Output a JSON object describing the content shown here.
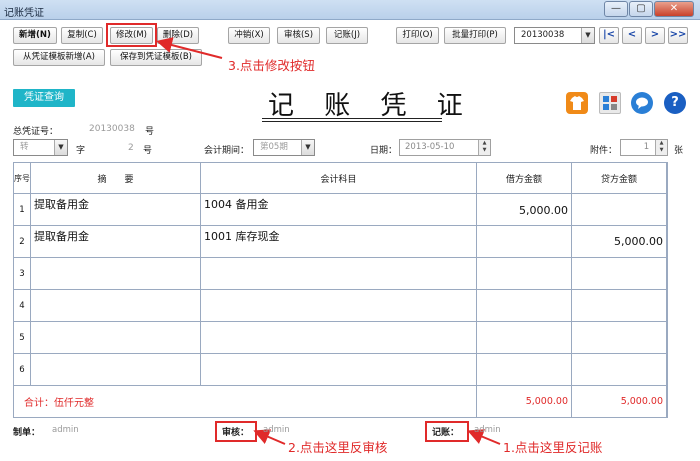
{
  "window": {
    "title": "记账凭证",
    "minimize": "—",
    "maximize": "▢",
    "close": "✕"
  },
  "toolbar": {
    "new": "新增(N)",
    "copy": "复制(C)",
    "modify": "修改(M)",
    "delete": "删除(D)",
    "reverse": "冲销(X)",
    "audit": "审核(S)",
    "post": "记账(J)",
    "print": "打印(O)",
    "batch_print": "批量打印(P)",
    "from_template": "从凭证模板新增(A)",
    "save_template": "保存到凭证模板(B)",
    "voucher_select": "20130038",
    "nav": {
      "first": "|<",
      "prev": "<",
      "next": ">",
      "last": ">>"
    }
  },
  "annotations": {
    "step1": "1.点击这里反记账",
    "step2": "2.点击这里反审核",
    "step3": "3.点击修改按钮"
  },
  "colors": {
    "accent_red": "#e02a2a",
    "tag_teal": "#1fb5c8"
  },
  "voucher": {
    "query_tag": "凭证查询",
    "title": "记 账 凭 证",
    "total_no_label": "总凭证号：",
    "total_no": "20130038",
    "total_no_suffix": "号",
    "type": "转",
    "type_suffix": "字",
    "number": "2",
    "number_suffix": "号",
    "period_label": "会计期间：",
    "period": "第05期",
    "date_label": "日期：",
    "date": "2013-05-10",
    "attach_label": "附件：",
    "attach": "1",
    "attach_suffix": "张",
    "icons": [
      "shirt-icon",
      "calculator-icon",
      "chat-icon",
      "help-icon"
    ]
  },
  "table": {
    "headers": {
      "seq": "序号",
      "summary": "摘　　要",
      "account": "会计科目",
      "debit": "借方金额",
      "credit": "贷方金额"
    },
    "rows": [
      {
        "seq": "1",
        "summary": "提取备用金",
        "account": "1004 备用金",
        "debit": "5,000.00",
        "credit": ""
      },
      {
        "seq": "2",
        "summary": "提取备用金",
        "account": "1001 库存现金",
        "debit": "",
        "credit": "5,000.00"
      },
      {
        "seq": "3",
        "summary": "",
        "account": "",
        "debit": "",
        "credit": ""
      },
      {
        "seq": "4",
        "summary": "",
        "account": "",
        "debit": "",
        "credit": ""
      },
      {
        "seq": "5",
        "summary": "",
        "account": "",
        "debit": "",
        "credit": ""
      },
      {
        "seq": "6",
        "summary": "",
        "account": "",
        "debit": "",
        "credit": ""
      }
    ],
    "total": {
      "label": "合计：伍仟元整",
      "debit": "5,000.00",
      "credit": "5,000.00"
    }
  },
  "footer": {
    "maker_label": "制单：",
    "maker": "admin",
    "auditor_label": "审核：",
    "auditor": "admin",
    "poster_label": "记账：",
    "poster": "admin"
  }
}
